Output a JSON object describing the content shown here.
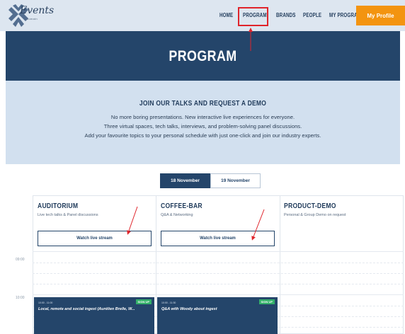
{
  "brand": {
    "logo_text": "Events",
    "logo_sub": "domain",
    "accent_color": "#f39410",
    "primary_color": "#24456a",
    "highlight_color": "#e0242b"
  },
  "nav": {
    "items": [
      {
        "label": "HOME"
      },
      {
        "label": "PROGRAM"
      },
      {
        "label": "BRANDS"
      },
      {
        "label": "PEOPLE"
      },
      {
        "label": "MY PROGRAM"
      }
    ],
    "profile_label": "My Profile"
  },
  "hero": {
    "title": "PROGRAM"
  },
  "intro": {
    "title": "JOIN OUR TALKS AND REQUEST A DEMO",
    "lines": [
      "No more boring presentations. New interactive live experiences for everyone.",
      "Three virtual spaces, tech talks, interviews, and problem-solving panel discussions.",
      "Add your favourite topics to your personal schedule with just one-click and join our industry experts."
    ]
  },
  "dates": {
    "active": "18 November",
    "inactive": "19 November"
  },
  "times": [
    "09:00",
    "10:00"
  ],
  "columns": [
    {
      "title": "AUDITORIUM",
      "subtitle": "Live tech talks & Panel discussions",
      "button": "Watch live stream",
      "session": {
        "time": "10:00 - 11:00",
        "title": "Local, remote and social ingest (Aurélien Brelle, W...",
        "badge": "SIGN UP"
      }
    },
    {
      "title": "COFFEE-BAR",
      "subtitle": "Q&A & Networking",
      "button": "Watch live stream",
      "session": {
        "time": "10:00 - 11:30",
        "title": "Q&A with Woody about ingest",
        "badge": "SIGN UP"
      }
    },
    {
      "title": "PRODUCT-DEMO",
      "subtitle": "Personal & Group Demo on request"
    }
  ]
}
